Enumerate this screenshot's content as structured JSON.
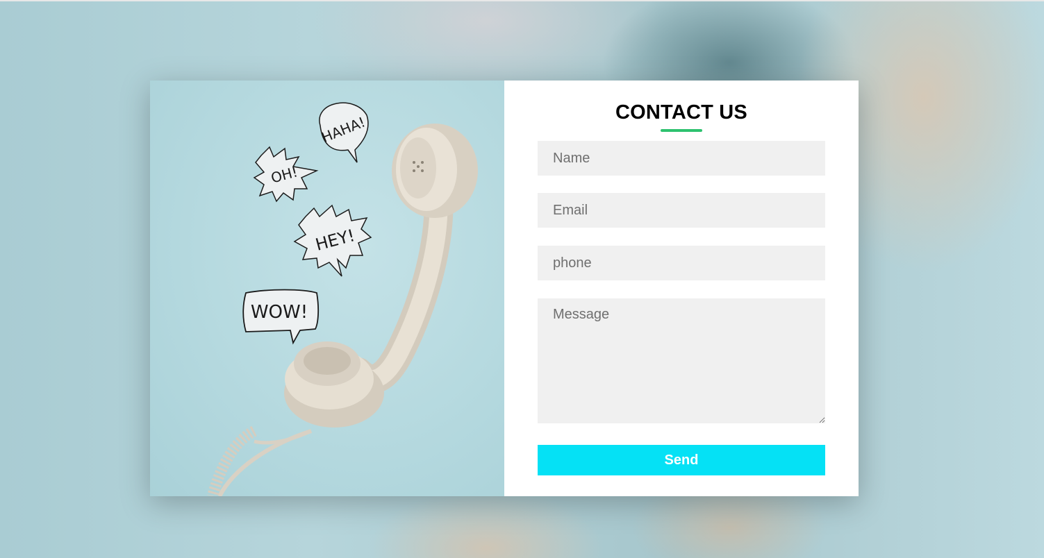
{
  "contact": {
    "title": "CONTACT US",
    "name_placeholder": "Name",
    "email_placeholder": "Email",
    "phone_placeholder": "phone",
    "message_placeholder": "Message",
    "send_label": "Send"
  },
  "illustration": {
    "bubbles": [
      "HAHA!",
      "OH!",
      "HEY!",
      "WOW!"
    ]
  },
  "colors": {
    "accent_button": "#05e1f5",
    "title_underline": "#2ec26f"
  }
}
